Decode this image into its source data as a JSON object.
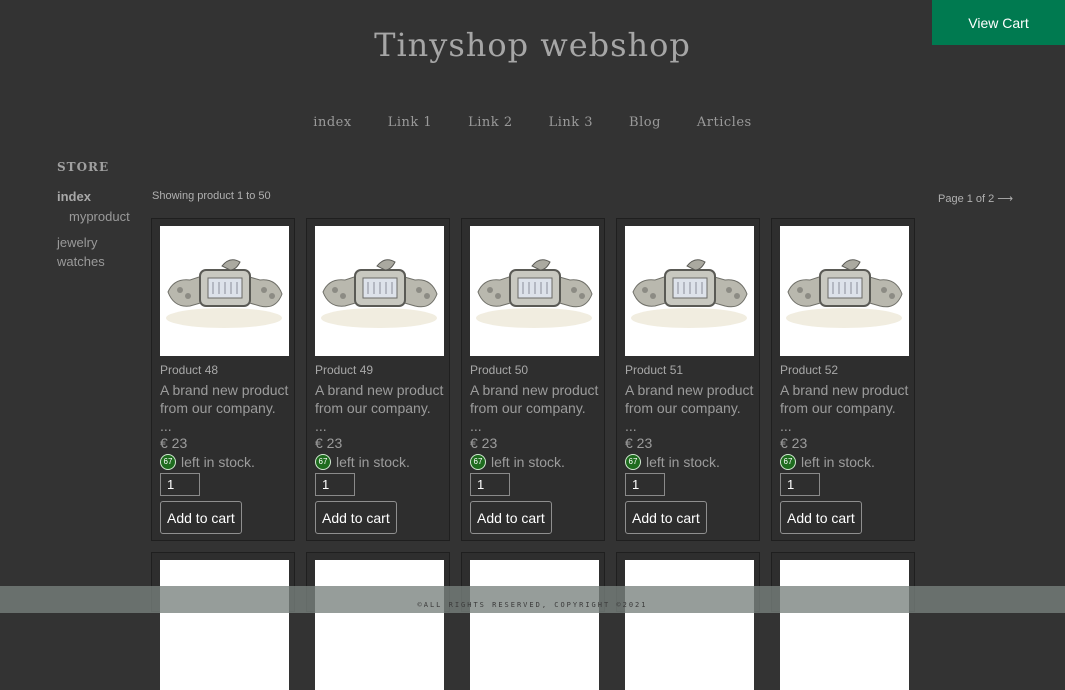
{
  "header": {
    "view_cart": "View Cart",
    "site_title": "Tinyshop webshop"
  },
  "nav": [
    "index",
    "Link 1",
    "Link 2",
    "Link 3",
    "Blog",
    "Articles"
  ],
  "sidebar": {
    "heading": "STORE",
    "items": [
      {
        "label": "index"
      },
      {
        "label": "myproduct"
      },
      {
        "label": "jewelry"
      },
      {
        "label": "watches"
      }
    ]
  },
  "listing": {
    "showing": "Showing product 1 to 50",
    "page": "Page 1 of 2",
    "page_arrow": "⟶"
  },
  "products": [
    {
      "name": "Product 48",
      "desc": "A brand new product from our company. ...",
      "price": "€ 23",
      "stock_count": "67",
      "stock_text": "left in stock.",
      "qty": "1",
      "add_label": "Add to cart"
    },
    {
      "name": "Product 49",
      "desc": "A brand new product from our company. ...",
      "price": "€ 23",
      "stock_count": "67",
      "stock_text": "left in stock.",
      "qty": "1",
      "add_label": "Add to cart"
    },
    {
      "name": "Product 50",
      "desc": "A brand new product from our company. ...",
      "price": "€ 23",
      "stock_count": "67",
      "stock_text": "left in stock.",
      "qty": "1",
      "add_label": "Add to cart"
    },
    {
      "name": "Product 51",
      "desc": "A brand new product from our company. ...",
      "price": "€ 23",
      "stock_count": "67",
      "stock_text": "left in stock.",
      "qty": "1",
      "add_label": "Add to cart"
    },
    {
      "name": "Product 52",
      "desc": "A brand new product from our company. ...",
      "price": "€ 23",
      "stock_count": "67",
      "stock_text": "left in stock.",
      "qty": "1",
      "add_label": "Add to cart"
    }
  ],
  "footer": {
    "text": "©ALL RIGHTS RESERVED, COPYRIGHT ©2021"
  },
  "colors": {
    "accent": "#007a50",
    "background": "#333333",
    "stock_badge": "#1e6b1e"
  }
}
